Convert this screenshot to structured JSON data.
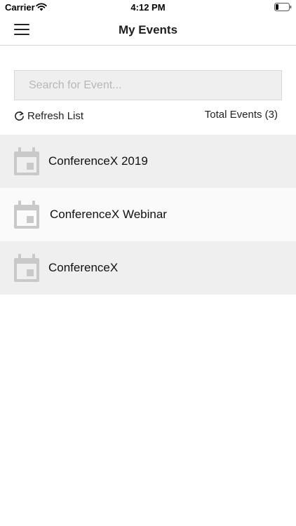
{
  "status_bar": {
    "carrier": "Carrier",
    "time": "4:12 PM",
    "wifi_icon": "wifi-icon",
    "battery_icon": "battery-icon"
  },
  "nav": {
    "title": "My Events",
    "menu_icon": "hamburger-menu-icon"
  },
  "search": {
    "placeholder": "Search for Event...",
    "value": ""
  },
  "refresh": {
    "label": "Refresh List",
    "icon": "refresh-icon"
  },
  "total": {
    "label": "Total Events (3)"
  },
  "events": [
    {
      "name": "ConferenceX 2019",
      "icon": "calendar-icon"
    },
    {
      "name": "ConferenceX Webinar",
      "icon": "calendar-icon"
    },
    {
      "name": "ConferenceX",
      "icon": "calendar-icon"
    }
  ],
  "colors": {
    "row_shade": "#efefef",
    "row_light": "#fafafa",
    "icon_gray": "#c9c9c9"
  }
}
